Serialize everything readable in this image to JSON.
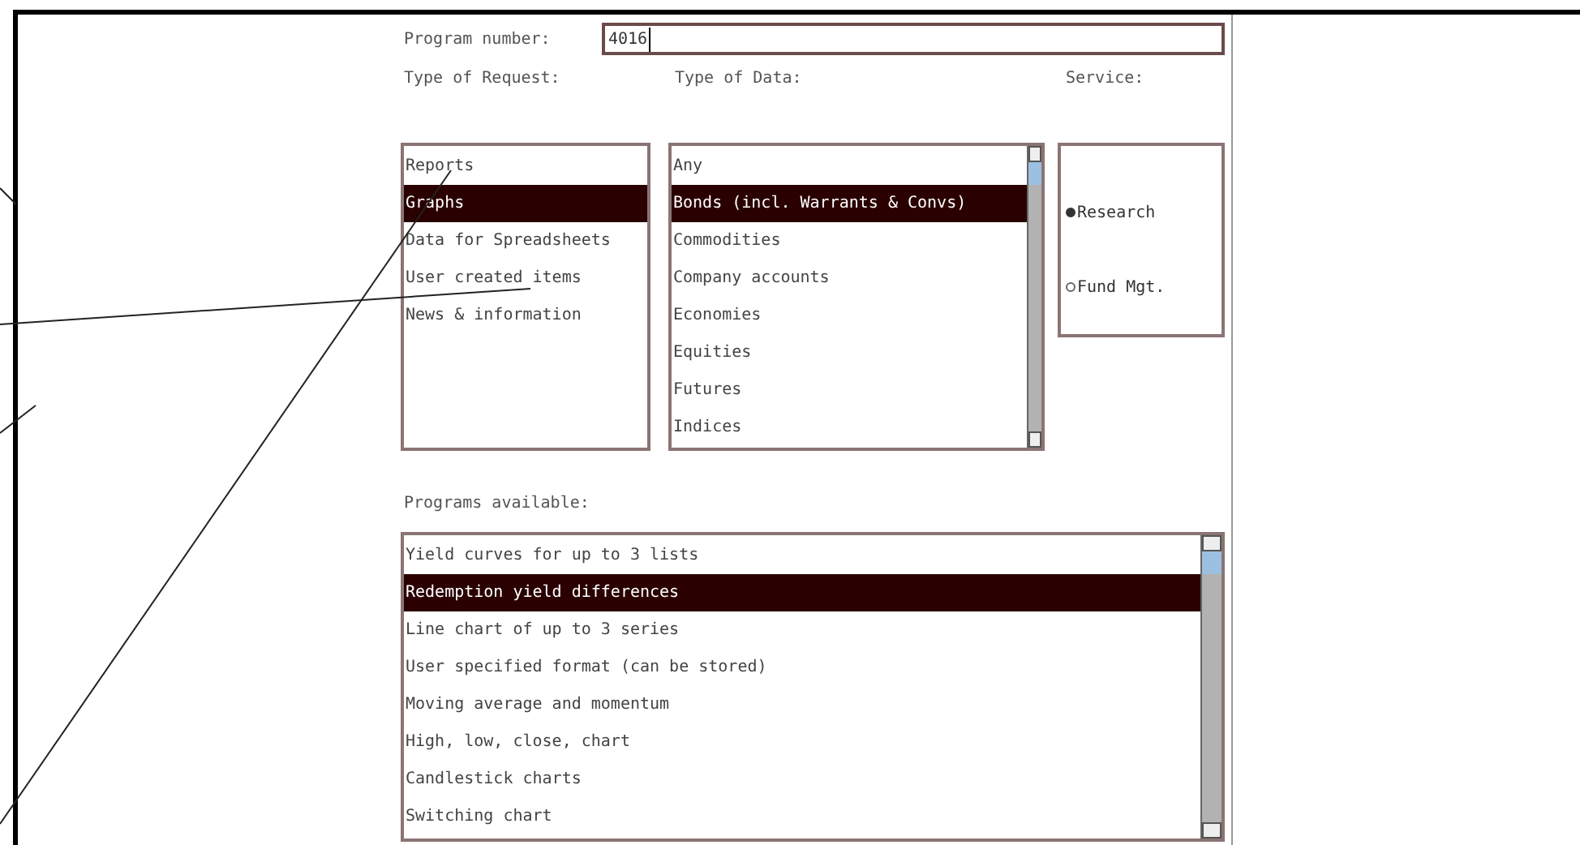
{
  "program_number": {
    "label": "Program number:",
    "value": "4016"
  },
  "request_type": {
    "label": "Type of Request:",
    "items": [
      {
        "text": "Reports",
        "selected": false
      },
      {
        "text": "Graphs",
        "selected": true
      },
      {
        "text": "Data for Spreadsheets",
        "selected": false
      },
      {
        "text": "User created items",
        "selected": false
      },
      {
        "text": "News & information",
        "selected": false
      }
    ]
  },
  "data_type": {
    "label": "Type of Data:",
    "items": [
      {
        "text": "Any",
        "selected": false
      },
      {
        "text": "Bonds (incl. Warrants & Convs)",
        "selected": true
      },
      {
        "text": "Commodities",
        "selected": false
      },
      {
        "text": "Company accounts",
        "selected": false
      },
      {
        "text": "Economies",
        "selected": false
      },
      {
        "text": "Equities",
        "selected": false
      },
      {
        "text": "Futures",
        "selected": false
      },
      {
        "text": "Indices",
        "selected": false
      }
    ]
  },
  "service": {
    "label": "Service:",
    "options": [
      {
        "text": "Research",
        "selected": true
      },
      {
        "text": "Fund Mgt.",
        "selected": false
      }
    ]
  },
  "programs": {
    "label": "Programs available:",
    "items": [
      {
        "text": "Yield curves for up to 3 lists",
        "selected": false
      },
      {
        "text": "Redemption yield differences",
        "selected": true
      },
      {
        "text": "Line chart of up to 3 series",
        "selected": false
      },
      {
        "text": "User specified format (can be stored)",
        "selected": false
      },
      {
        "text": "Moving average and momentum",
        "selected": false
      },
      {
        "text": "High, low, close, chart",
        "selected": false
      },
      {
        "text": "Candlestick charts",
        "selected": false
      },
      {
        "text": "Switching chart",
        "selected": false
      }
    ]
  }
}
